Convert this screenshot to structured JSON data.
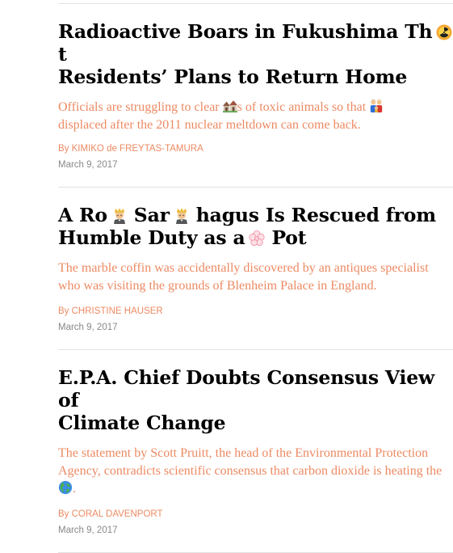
{
  "articles": [
    {
      "headline_a": "Radioactive Boars in Fukushima Th",
      "headline_b": " t",
      "headline_c": "Residents’ Plans to Return Home",
      "summary_a": "Officials are struggling to clear ",
      "summary_b": "s of toxic animals so that ",
      "summary_c": "displaced after the 2011 nuclear meltdown can come back.",
      "byline_prefix": "By ",
      "author": "KIMIKO de FREYTAS-TAMURA",
      "date": "March 9, 2017",
      "icons": [
        "radioactive-sun-emoji",
        "houses-emoji",
        "family-emoji"
      ]
    },
    {
      "headline_a": "A Ro",
      "headline_b": " Sar",
      "headline_c": " hagus Is Rescued from",
      "headline_d": "Humble Duty as a",
      "headline_e": " Pot",
      "summary": "The marble coffin was accidentally discovered by an antiques specialist who was visiting the grounds of Blenheim Palace in England.",
      "byline_prefix": "By ",
      "author": "CHRISTINE HAUSER",
      "date": "March 9, 2017",
      "icons": [
        "prince-emoji",
        "prince-emoji",
        "flower-emoji"
      ]
    },
    {
      "headline_a": "E.P.A. Chief Doubts Consensus View of",
      "headline_b": "Climate Change",
      "summary_a": "The statement by Scott Pruitt, the head of the Environmental Protection Agency, contradicts scientific consensus that carbon dioxide is heating the ",
      "summary_b": ".",
      "byline_prefix": "By ",
      "author": "CORAL DAVENPORT",
      "date": "March 9, 2017",
      "icons": [
        "globe-emoji"
      ]
    }
  ],
  "colors": {
    "headline": "#000000",
    "summary": "#ec8a63",
    "byline": "#ec8a63",
    "date": "#888888",
    "divider": "#e2e2e2"
  }
}
